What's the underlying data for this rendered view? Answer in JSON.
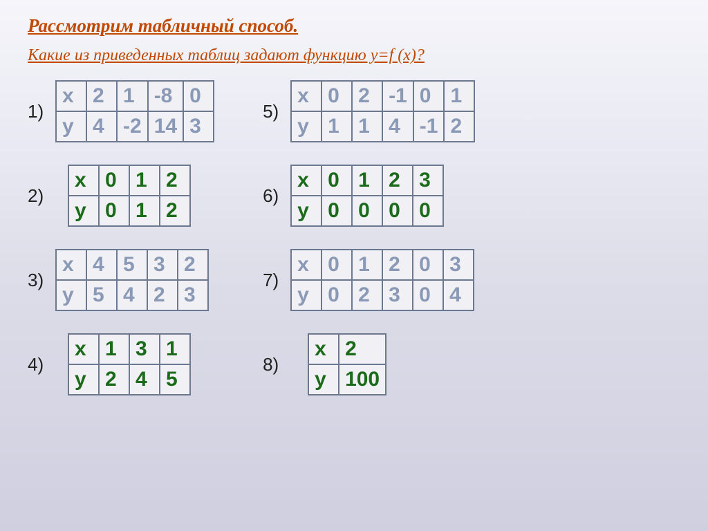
{
  "title": "Рассмотрим табличный способ.",
  "subtitle": "Какие из приведенных таблиц задают функцию y=f (x)?",
  "labels": {
    "t1": "1)",
    "t2": "2)",
    "t3": "3)",
    "t4": "4)",
    "t5": "5)",
    "t6": "6)",
    "t7": "7)",
    "t8": "8)"
  },
  "tables": {
    "t1": {
      "x": [
        "2",
        "1",
        "-8",
        "0"
      ],
      "y": [
        "4",
        "-2",
        "14",
        "3"
      ]
    },
    "t2": {
      "x": [
        "0",
        "1",
        "2"
      ],
      "y": [
        "0",
        "1",
        "2"
      ]
    },
    "t3": {
      "x": [
        "4",
        "5",
        "3",
        "2"
      ],
      "y": [
        "5",
        "4",
        "2",
        "3"
      ]
    },
    "t4": {
      "x": [
        "1",
        "3",
        "1"
      ],
      "y": [
        "2",
        "4",
        "5"
      ]
    },
    "t5": {
      "x": [
        "0",
        "2",
        "-1",
        "0",
        "1"
      ],
      "y": [
        "1",
        "1",
        "4",
        "-1",
        "2"
      ]
    },
    "t6": {
      "x": [
        "0",
        "1",
        "2",
        "3"
      ],
      "y": [
        "0",
        "0",
        "0",
        "0"
      ]
    },
    "t7": {
      "x": [
        "0",
        "1",
        "2",
        "0",
        "3"
      ],
      "y": [
        "0",
        "2",
        "3",
        "0",
        "4"
      ]
    },
    "t8": {
      "x": [
        "2"
      ],
      "y": [
        "100"
      ]
    }
  },
  "rowhead": {
    "x": "x",
    "y": "y"
  }
}
